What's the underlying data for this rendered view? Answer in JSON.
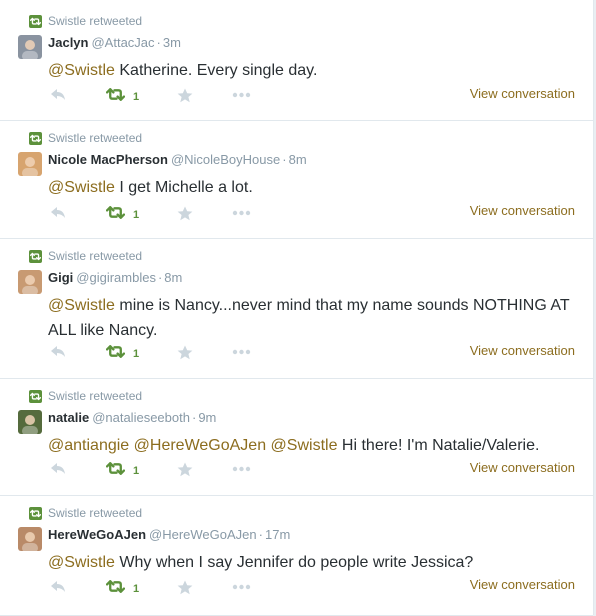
{
  "colors": {
    "link": "#8c6d1f",
    "retweet_green": "#5c913b",
    "muted": "#8899a6",
    "text": "#292f33"
  },
  "tweets": [
    {
      "context": "Swistle retweeted",
      "fullname": "Jaclyn",
      "screen_name": "@AttacJac",
      "sep": "·",
      "time": "3m",
      "segments": [
        {
          "text": "@Swistle",
          "type": "mention"
        },
        {
          "text": " Katherine. Every single day.",
          "type": "plain"
        }
      ],
      "retweet_count": "1",
      "view_conversation": "View conversation"
    },
    {
      "context": "Swistle retweeted",
      "fullname": "Nicole MacPherson",
      "screen_name": "@NicoleBoyHouse",
      "sep": "·",
      "time": "8m",
      "segments": [
        {
          "text": "@Swistle",
          "type": "mention"
        },
        {
          "text": " I get Michelle a lot.",
          "type": "plain"
        }
      ],
      "retweet_count": "1",
      "view_conversation": "View conversation"
    },
    {
      "context": "Swistle retweeted",
      "fullname": "Gigi",
      "screen_name": "@gigirambles",
      "sep": "·",
      "time": "8m",
      "segments": [
        {
          "text": "@Swistle",
          "type": "mention"
        },
        {
          "text": " mine is Nancy...never mind that my name sounds NOTHING AT ALL like Nancy.",
          "type": "plain"
        }
      ],
      "retweet_count": "1",
      "view_conversation": "View conversation"
    },
    {
      "context": "Swistle retweeted",
      "fullname": "natalie",
      "screen_name": "@natalieseeboth",
      "sep": "·",
      "time": "9m",
      "segments": [
        {
          "text": "@antiangie",
          "type": "mention"
        },
        {
          "text": " ",
          "type": "plain"
        },
        {
          "text": "@HereWeGoAJen",
          "type": "mention"
        },
        {
          "text": " ",
          "type": "plain"
        },
        {
          "text": "@Swistle",
          "type": "mention"
        },
        {
          "text": " Hi there! I'm Natalie/Valerie.",
          "type": "plain"
        }
      ],
      "retweet_count": "1",
      "view_conversation": "View conversation"
    },
    {
      "context": "Swistle retweeted",
      "fullname": "HereWeGoAJen",
      "screen_name": "@HereWeGoAJen",
      "sep": "·",
      "time": "17m",
      "segments": [
        {
          "text": "@Swistle",
          "type": "mention"
        },
        {
          "text": " Why when I say Jennifer do people write Jessica?",
          "type": "plain"
        }
      ],
      "retweet_count": "1",
      "view_conversation": "View conversation"
    }
  ],
  "icons": {
    "context": "retweet-icon",
    "reply": "reply-icon",
    "retweet": "retweet-icon",
    "favorite": "star-icon",
    "more": "more-icon"
  }
}
